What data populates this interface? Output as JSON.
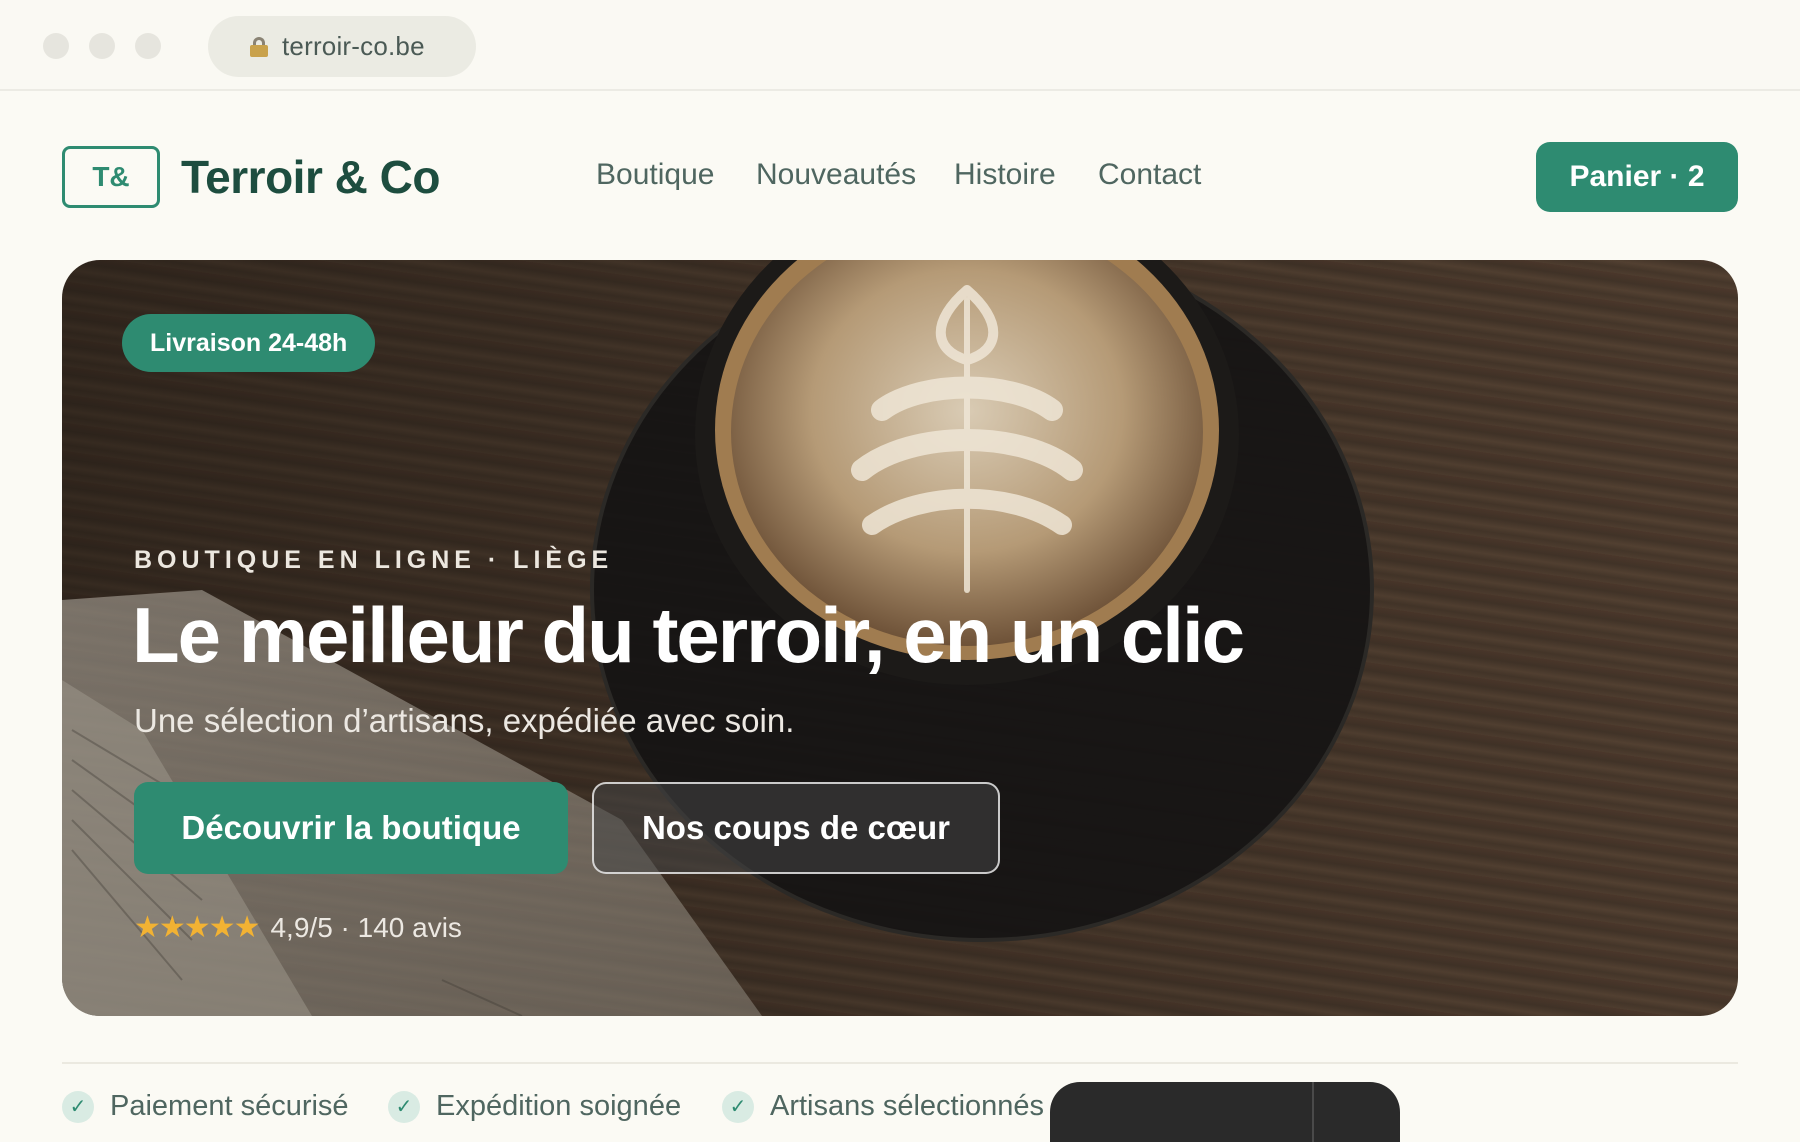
{
  "browser": {
    "url": "terroir-co.be"
  },
  "header": {
    "logo_mark": "T&",
    "brand": "Terroir & Co",
    "nav": [
      "Boutique",
      "Nouveautés",
      "Histoire",
      "Contact"
    ],
    "cart_label": "Panier · 2"
  },
  "hero": {
    "badge": "Livraison 24-48h",
    "eyebrow": "BOUTIQUE EN LIGNE · LIÈGE",
    "headline": "Le meilleur du terroir, en un clic",
    "subhead": "Une sélection d’artisans, expédiée avec soin.",
    "primary_cta": "Découvrir la boutique",
    "secondary_cta": "Nos coups de cœur",
    "stars": "★★★★★",
    "rating_text": "4,9/5 · 140 avis",
    "rating_value": 4.9
  },
  "trust": [
    "Paiement sécurisé",
    "Expédition soignée",
    "Artisans sélectionnés"
  ],
  "colors": {
    "accent": "#2e8b71",
    "brand_text": "#1d4d3f",
    "star": "#f2b233"
  }
}
